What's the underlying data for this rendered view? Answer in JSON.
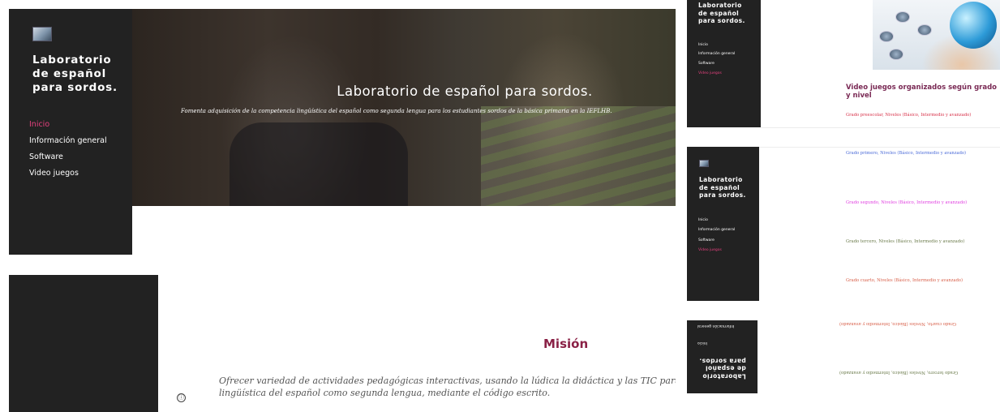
{
  "site": {
    "title": "Laboratorio de español para sordos.",
    "title_lines": [
      "Laboratorio",
      "de español",
      "para sordos."
    ]
  },
  "nav": {
    "items": [
      "Inicio",
      "Información general",
      "Software",
      "Video juegos"
    ]
  },
  "hero": {
    "title": "Laboratorio de español  para sordos.",
    "subtitle": "Fomenta adquisición  de la competencia lingüística del español como segunda lengua  para los estudiantes sordos de la básica primaria  en  la IEFLHB."
  },
  "mission": {
    "heading": "Misión",
    "text_line1": "Ofrecer variedad de actividades pedagógicas interactivas, usando la lúdica la didáctica y las TIC para que lo",
    "text_line2": "lingüística del español como segunda lengua, mediante el código escrito."
  },
  "games": {
    "heading": "Video juegos organizados según grado y nivel",
    "levels": [
      "Grado preescolar, Niveles (Básico, Intermedio y avanzado)",
      "Grado primero, Niveles (Básico, Intermedio y avanzado)",
      "Grado segundo, Niveles (Básico, Intermedio y avanzado)",
      "Grado tercero, Niveles (Básico, Intermedio y avanzado)",
      "Grado cuarto, Niveles (Básico, Intermedio y avanzado)"
    ],
    "mirrored_level_a": "Grado cuarto, Niveles (Básico, Intermedio y avanzado)",
    "mirrored_level_b": "Grado tercero, Niveles (Básico, Intermedio y avanzado)"
  },
  "mirrored_nav": {
    "item_a": "Información general",
    "item_b": "Inicio"
  },
  "icons": {
    "info": "ⓘ"
  },
  "colors": {
    "sidebar": "#222222",
    "accent_pink": "#e5407e",
    "mission_heading": "#8a2146",
    "level_colors": [
      "#d8324a",
      "#4a6ad8",
      "#e040e0",
      "#6a7a4a",
      "#d8604a"
    ]
  }
}
